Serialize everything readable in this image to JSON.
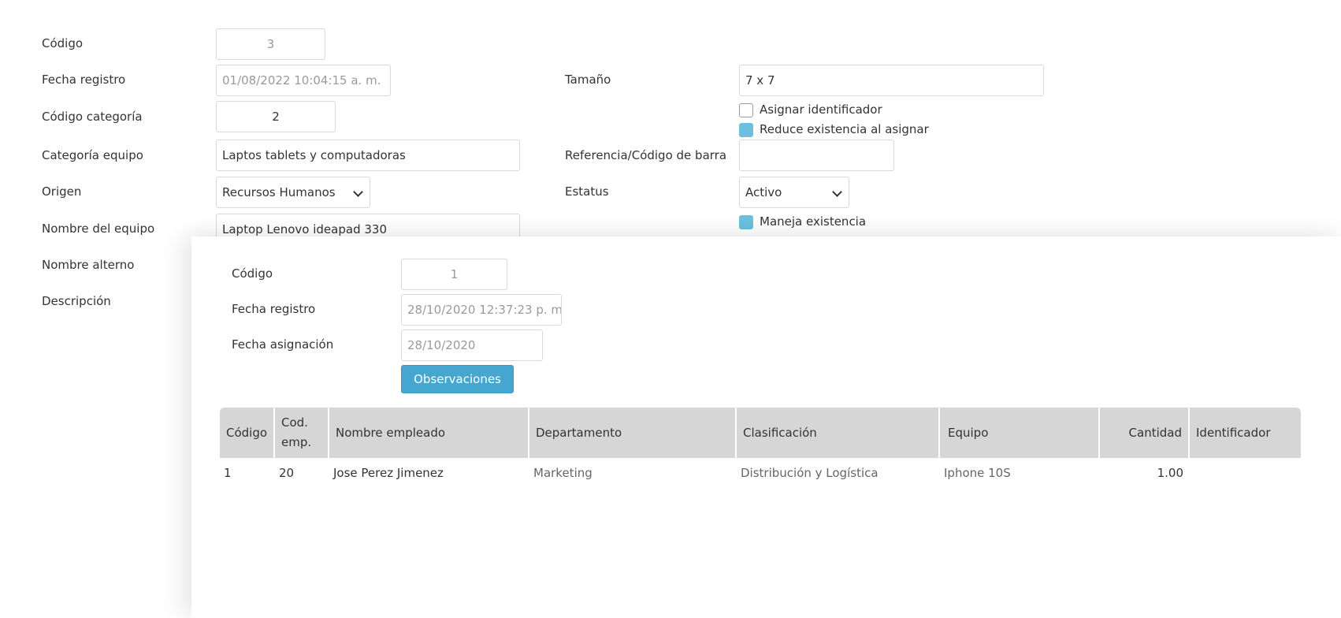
{
  "form": {
    "codigo": {
      "label": "Código",
      "value": "3"
    },
    "fecha_registro": {
      "label": "Fecha registro",
      "value": "01/08/2022 10:04:15 a. m."
    },
    "codigo_categoria": {
      "label": "Código categoría",
      "value": "2"
    },
    "categoria_equipo": {
      "label": "Categoría equipo",
      "value": "Laptos tablets y computadoras"
    },
    "origen": {
      "label": "Origen",
      "value": "Recursos Humanos"
    },
    "nombre_equipo": {
      "label": "Nombre del equipo",
      "value": "Laptop Lenovo ideapad 330"
    },
    "nombre_alterno": {
      "label": "Nombre alterno"
    },
    "descripcion": {
      "label": "Descripción"
    },
    "tamano": {
      "label": "Tamaño",
      "value": "7 x 7"
    },
    "asignar_identificador": {
      "label": "Asignar identificador",
      "checked": false
    },
    "reduce_existencia": {
      "label": "Reduce existencia al asignar",
      "checked": true
    },
    "referencia": {
      "label": "Referencia/Código de barra",
      "value": ""
    },
    "estatus": {
      "label": "Estatus",
      "value": "Activo"
    },
    "maneja_existencia": {
      "label": "Maneja existencia",
      "checked": true
    }
  },
  "assignment": {
    "codigo": {
      "label": "Código",
      "value": "1"
    },
    "fecha_registro": {
      "label": "Fecha registro",
      "value": "28/10/2020 12:37:23 p. m"
    },
    "fecha_asignacion": {
      "label": "Fecha asignación",
      "value": "28/10/2020"
    },
    "observaciones_button": "Observaciones",
    "table": {
      "columns": [
        "Código",
        "Cod. emp.",
        "Nombre empleado",
        "Departamento",
        "Clasificación",
        "Equipo",
        "Cantidad",
        "Identificador"
      ],
      "rows": [
        [
          "1",
          "20",
          "Jose Perez Jimenez",
          "Marketing",
          "Distribución y Logística",
          "Iphone 10S",
          "1.00",
          ""
        ]
      ]
    }
  },
  "colors": {
    "accent": "#45a6cf",
    "checkbox_checked": "#6cc0de",
    "header_bg": "#d6d6d6"
  }
}
